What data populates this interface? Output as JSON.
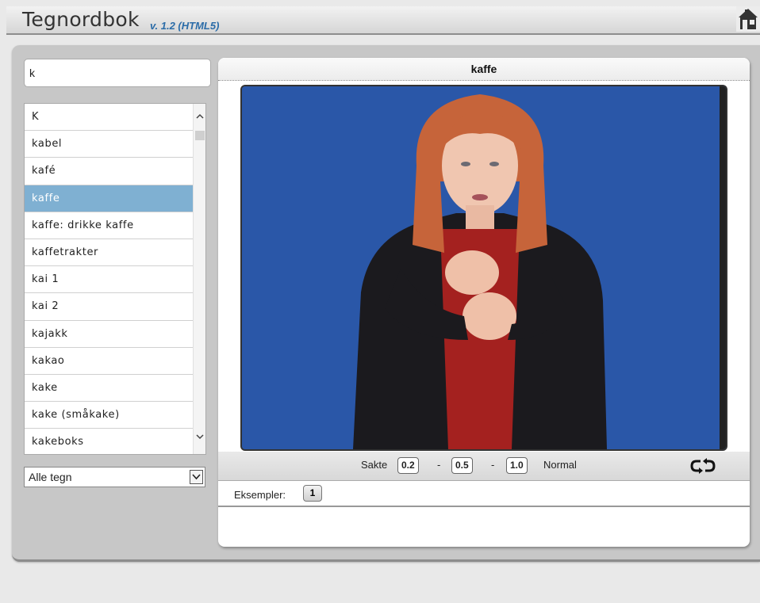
{
  "header": {
    "title": "Tegnordbok",
    "version": "v. 1.2 (HTML5)",
    "home_icon": "home-icon"
  },
  "search": {
    "value": "k",
    "placeholder": ""
  },
  "word_list": {
    "items": [
      "K",
      "kabel",
      "kafé",
      "kaffe",
      "kaffe: drikke kaffe",
      "kaffetrakter",
      "kai 1",
      "kai 2",
      "kajakk",
      "kakao",
      "kake",
      "kake (småkake)",
      "kakeboks"
    ],
    "selected_index": 3
  },
  "filter": {
    "selected": "Alle tegn"
  },
  "card": {
    "title": "kaffe",
    "controls": {
      "slow_label": "Sakte",
      "speeds": [
        "0.2",
        "0.5",
        "1.0"
      ],
      "separator": "-",
      "normal_label": "Normal",
      "loop_icon": "loop-icon"
    },
    "examples": {
      "label": "Eksempler:",
      "buttons": [
        "1"
      ]
    }
  },
  "colors": {
    "video_background": "#2a57a8",
    "selected_row": "#7fb0d2",
    "version_text": "#2b6ca8"
  }
}
